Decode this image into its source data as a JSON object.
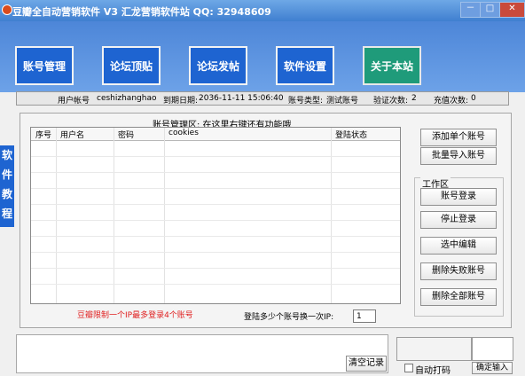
{
  "window": {
    "title": "豆瓣全自动营销软件 V3 汇龙营销软件站   QQ: 32948609",
    "min_label": "－",
    "max_label": "□",
    "close_label": "✕"
  },
  "nav": {
    "buttons": [
      "账号管理",
      "论坛顶贴",
      "论坛发帖",
      "软件设置",
      "关于本站"
    ],
    "active_index": 4
  },
  "info": {
    "user_label": "用户帐号",
    "user_value": "ceshizhanghao",
    "expire_label": "到期日期:",
    "expire_value": "2036-11-11 15:06:40",
    "type_label": "账号类型:",
    "type_value": "测试账号",
    "verify_label": "验证次数:",
    "verify_value": "2",
    "recharge_label": "充值次数:",
    "recharge_value": "0"
  },
  "sidebar": {
    "chars": [
      "软",
      "件",
      "教",
      "程"
    ]
  },
  "account_area": {
    "title": "账号管理区:     在这里右键还有功能哦",
    "columns": [
      "序号",
      "用户名",
      "密码",
      "cookies",
      "登陆状态"
    ],
    "rows": []
  },
  "right_buttons": {
    "add_single": "添加单个账号",
    "batch_import": "批量导入账号"
  },
  "workarea": {
    "label": "工作区",
    "login": "账号登录",
    "stop_login": "停止登录",
    "edit_selected": "选中编辑",
    "delete_failed": "删除失败账号",
    "delete_all": "删除全部账号"
  },
  "limits": {
    "ip_warning": "豆瓣限制一个IP最多登录4个账号",
    "switch_label": "登陆多少个账号换一次IP:",
    "switch_value": "1"
  },
  "bottom": {
    "clear_log": "清空记录",
    "auto_captcha_label": "自动打码",
    "confirm_input": "确定输入"
  },
  "colors": {
    "nav_blue": "#1e64d1",
    "nav_active": "#1f9b7a",
    "warning_red": "#e02020",
    "title_bar": "#3f7fd0"
  },
  "icons": [
    "app-icon",
    "minimize-icon",
    "maximize-icon",
    "close-icon"
  ]
}
